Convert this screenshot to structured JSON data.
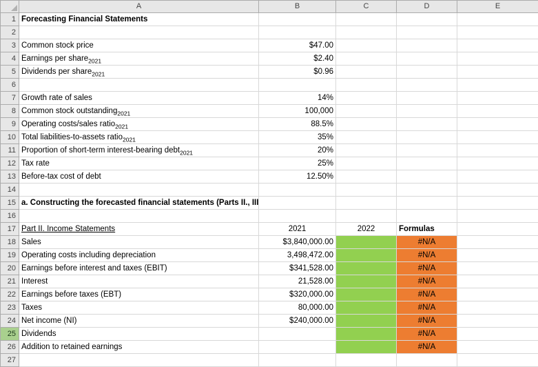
{
  "colors": {
    "green_fill": "#92D050",
    "orange_fill": "#ED7D31",
    "header_bg": "#E7E7E7",
    "header_border": "#ABABAB",
    "gridline": "#D8D8D8",
    "selected_row_header_bg": "#A9D08E",
    "border_black": "#000000"
  },
  "sheet": {
    "columns": [
      "A",
      "B",
      "C",
      "D",
      "E"
    ],
    "selected_row": 25,
    "rows": [
      {
        "n": 1,
        "cells": [
          {
            "col": "A",
            "text": "Forecasting Financial Statements",
            "bold": true,
            "overflow": true
          }
        ]
      },
      {
        "n": 2,
        "cells": []
      },
      {
        "n": 3,
        "cells": [
          {
            "col": "A",
            "text": "Common stock price"
          },
          {
            "col": "B",
            "text": "$47.00",
            "align": "right"
          }
        ]
      },
      {
        "n": 4,
        "cells": [
          {
            "col": "A",
            "text": "Earnings per share",
            "sub": "2021"
          },
          {
            "col": "B",
            "text": "$2.40",
            "align": "right"
          }
        ]
      },
      {
        "n": 5,
        "cells": [
          {
            "col": "A",
            "text": "Dividends per share",
            "sub": "2021"
          },
          {
            "col": "B",
            "text": "$0.96",
            "align": "right"
          }
        ]
      },
      {
        "n": 6,
        "cells": []
      },
      {
        "n": 7,
        "cells": [
          {
            "col": "A",
            "text": "Growth rate of sales"
          },
          {
            "col": "B",
            "text": "14%",
            "align": "right"
          }
        ]
      },
      {
        "n": 8,
        "cells": [
          {
            "col": "A",
            "text": "Common stock outstanding",
            "sub": "2021"
          },
          {
            "col": "B",
            "text": "100,000",
            "align": "right"
          }
        ]
      },
      {
        "n": 9,
        "cells": [
          {
            "col": "A",
            "text": "Operating costs/sales ratio",
            "sub": "2021"
          },
          {
            "col": "B",
            "text": "88.5%",
            "align": "right"
          }
        ]
      },
      {
        "n": 10,
        "cells": [
          {
            "col": "A",
            "text": "Total liabilities-to-assets ratio",
            "sub": "2021"
          },
          {
            "col": "B",
            "text": "35%",
            "align": "right"
          }
        ]
      },
      {
        "n": 11,
        "cells": [
          {
            "col": "A",
            "text": "Proportion of short-term interest-bearing debt",
            "sub": "2021"
          },
          {
            "col": "B",
            "text": "20%",
            "align": "right"
          }
        ]
      },
      {
        "n": 12,
        "cells": [
          {
            "col": "A",
            "text": "Tax rate"
          },
          {
            "col": "B",
            "text": "25%",
            "align": "right"
          }
        ]
      },
      {
        "n": 13,
        "cells": [
          {
            "col": "A",
            "text": "Before-tax cost of debt"
          },
          {
            "col": "B",
            "text": "12.50%",
            "align": "right"
          }
        ]
      },
      {
        "n": 14,
        "cells": []
      },
      {
        "n": 15,
        "cells": [
          {
            "col": "A",
            "text": "a.  Constructing the forecasted financial statements (Parts II., III., and IV.)",
            "bold": true,
            "overflow": true
          }
        ]
      },
      {
        "n": 16,
        "cells": []
      },
      {
        "n": 17,
        "cells": [
          {
            "col": "A",
            "text": "Part II. Income Statements",
            "underline": true,
            "border_top": true,
            "border_bottom": true
          },
          {
            "col": "B",
            "text": "2021",
            "align": "center",
            "border_top": true,
            "border_bottom": true
          },
          {
            "col": "C",
            "text": "2022",
            "align": "center",
            "border_top": true,
            "border_bottom": true
          },
          {
            "col": "D",
            "text": "Formulas",
            "bold": true,
            "border_top": true,
            "border_bottom": true
          }
        ]
      },
      {
        "n": 18,
        "cells": [
          {
            "col": "A",
            "text": "Sales"
          },
          {
            "col": "B",
            "text": "$3,840,000.00",
            "align": "right"
          },
          {
            "col": "C",
            "fill": "green"
          },
          {
            "col": "D",
            "text": "#N/A",
            "fill": "orange",
            "align": "center"
          }
        ]
      },
      {
        "n": 19,
        "cells": [
          {
            "col": "A",
            "text": "Operating costs including depreciation"
          },
          {
            "col": "B",
            "text": "3,498,472.00",
            "align": "right",
            "border_bottom": true
          },
          {
            "col": "C",
            "fill": "green",
            "border_bottom": true
          },
          {
            "col": "D",
            "text": "#N/A",
            "fill": "orange",
            "align": "center"
          }
        ]
      },
      {
        "n": 20,
        "cells": [
          {
            "col": "A",
            "text": "Earnings before interest and taxes (EBIT)"
          },
          {
            "col": "B",
            "text": "$341,528.00",
            "align": "right"
          },
          {
            "col": "C",
            "fill": "green"
          },
          {
            "col": "D",
            "text": "#N/A",
            "fill": "orange",
            "align": "center"
          }
        ]
      },
      {
        "n": 21,
        "cells": [
          {
            "col": "A",
            "text": "Interest"
          },
          {
            "col": "B",
            "text": "21,528.00",
            "align": "right",
            "border_bottom": true
          },
          {
            "col": "C",
            "fill": "green",
            "border_bottom": true
          },
          {
            "col": "D",
            "text": "#N/A",
            "fill": "orange",
            "align": "center"
          }
        ]
      },
      {
        "n": 22,
        "cells": [
          {
            "col": "A",
            "text": "Earnings before taxes (EBT)"
          },
          {
            "col": "B",
            "text": "$320,000.00",
            "align": "right"
          },
          {
            "col": "C",
            "fill": "green"
          },
          {
            "col": "D",
            "text": "#N/A",
            "fill": "orange",
            "align": "center"
          }
        ]
      },
      {
        "n": 23,
        "cells": [
          {
            "col": "A",
            "text": "Taxes"
          },
          {
            "col": "B",
            "text": "80,000.00",
            "align": "right",
            "border_bottom": true
          },
          {
            "col": "C",
            "fill": "green",
            "border_bottom": true
          },
          {
            "col": "D",
            "text": "#N/A",
            "fill": "orange",
            "align": "center"
          }
        ]
      },
      {
        "n": 24,
        "cells": [
          {
            "col": "A",
            "text": "Net income (NI)"
          },
          {
            "col": "B",
            "text": "$240,000.00",
            "align": "right",
            "border_double": true
          },
          {
            "col": "C",
            "fill": "green",
            "border_double": true
          },
          {
            "col": "D",
            "text": "#N/A",
            "fill": "orange",
            "align": "center"
          }
        ]
      },
      {
        "n": 25,
        "cells": [
          {
            "col": "A",
            "text": "Dividends"
          },
          {
            "col": "C",
            "fill": "green"
          },
          {
            "col": "D",
            "text": "#N/A",
            "fill": "orange",
            "align": "center"
          }
        ]
      },
      {
        "n": 26,
        "cells": [
          {
            "col": "A",
            "text": "Addition to retained earnings"
          },
          {
            "col": "C",
            "fill": "green"
          },
          {
            "col": "D",
            "text": "#N/A",
            "fill": "orange",
            "align": "center"
          }
        ]
      },
      {
        "n": 27,
        "cells": []
      }
    ]
  }
}
